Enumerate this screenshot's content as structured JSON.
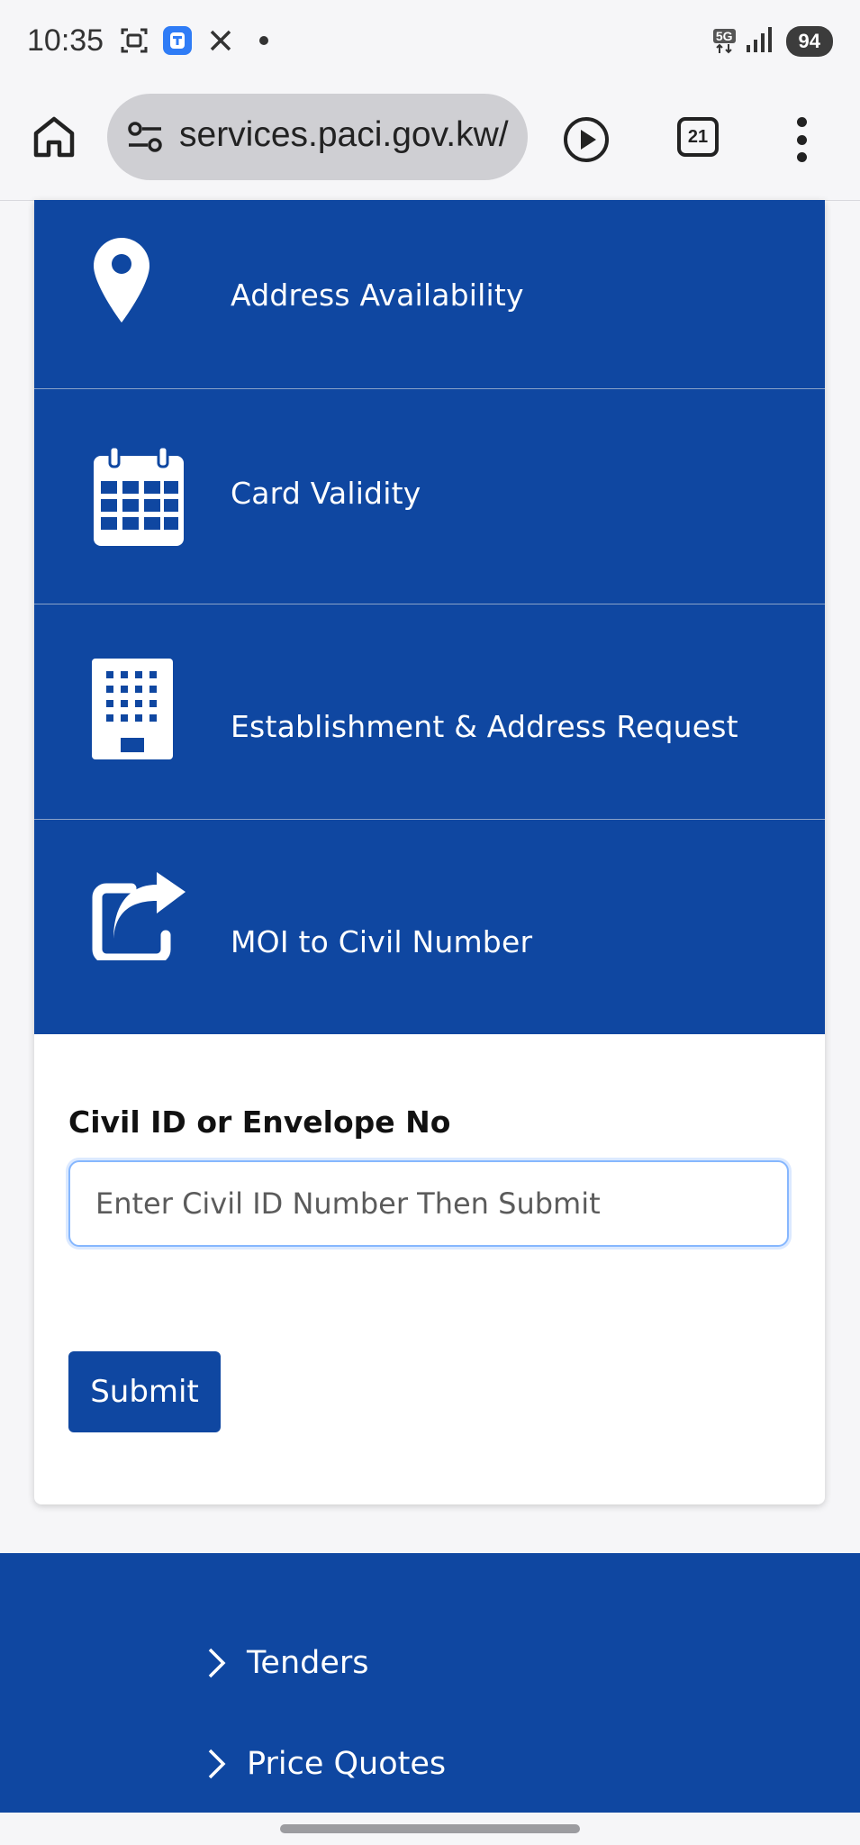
{
  "status_bar": {
    "time": "10:35",
    "network": "5G",
    "battery": "94"
  },
  "browser": {
    "url": "services.paci.gov.kw/",
    "tab_count": "21"
  },
  "services": [
    {
      "label": "Address Availability",
      "icon": "map-pin-icon"
    },
    {
      "label": "Card Validity",
      "icon": "calendar-icon"
    },
    {
      "label": "Establishment & Address Request",
      "icon": "building-icon"
    },
    {
      "label": "MOI to Civil Number",
      "icon": "share-icon"
    }
  ],
  "form": {
    "civil_label": "Civil ID or Envelope No",
    "civil_placeholder": "Enter Civil ID Number Then Submit",
    "submit_label": "Submit"
  },
  "footer": {
    "links": [
      "Tenders",
      "Price Quotes"
    ]
  },
  "colors": {
    "brand_blue": "#0f47a1"
  }
}
